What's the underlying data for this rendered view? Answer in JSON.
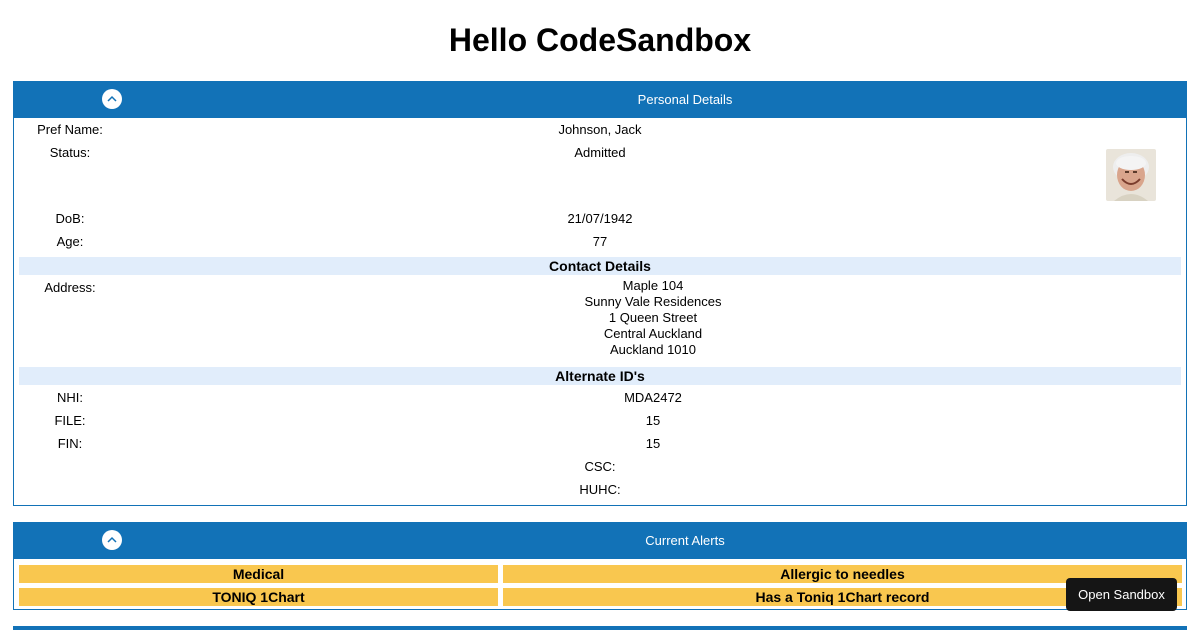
{
  "page": {
    "title": "Hello CodeSandbox"
  },
  "personal": {
    "header": "Personal Details",
    "rows": [
      {
        "label": "Pref Name:",
        "value": "Johnson, Jack"
      },
      {
        "label": "Status:",
        "value": "Admitted"
      },
      {
        "label": "DoB:",
        "value": "21/07/1942"
      },
      {
        "label": "Age:",
        "value": "77"
      }
    ],
    "contact": {
      "header": "Contact Details",
      "address_label": "Address:",
      "address_lines": [
        "Maple 104",
        "Sunny Vale Residences",
        "1 Queen Street",
        "Central Auckland",
        "Auckland 1010"
      ]
    },
    "alternate": {
      "header": "Alternate ID's",
      "rows": [
        {
          "label": "NHI:",
          "value": "MDA2472"
        },
        {
          "label": "FILE:",
          "value": "15"
        },
        {
          "label": "FIN:",
          "value": "15"
        }
      ],
      "extra_labels": [
        "CSC:",
        "HUHC:"
      ]
    }
  },
  "alerts": {
    "header": "Current Alerts",
    "rows": [
      {
        "type": "Medical",
        "description": "Allergic to needles"
      },
      {
        "type": "TONIQ 1Chart",
        "description": "Has a Toniq 1Chart record"
      }
    ]
  },
  "sandbox_button": {
    "label": "Open Sandbox"
  },
  "colors": {
    "header_blue": "#1272b7",
    "section_bg": "#e1edfb",
    "alert_bg": "#f9c74f",
    "button_bg": "#151515"
  },
  "icons": {
    "collapse": "chevron-up-icon",
    "avatar": "patient-photo"
  }
}
